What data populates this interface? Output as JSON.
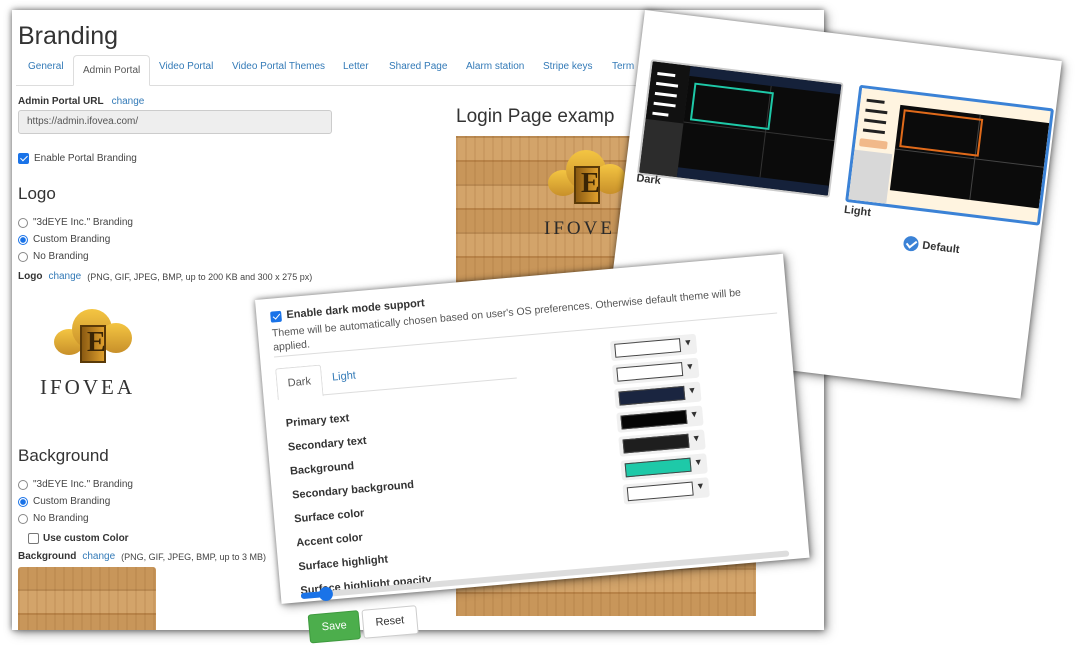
{
  "main": {
    "title": "Branding",
    "tabs": [
      {
        "label": "General"
      },
      {
        "label": "Admin Portal"
      },
      {
        "label": "Video Portal"
      },
      {
        "label": "Video Portal Themes"
      },
      {
        "label": "Letter"
      },
      {
        "label": "Shared Page"
      },
      {
        "label": "Alarm station"
      },
      {
        "label": "Stripe keys"
      },
      {
        "label": "Term"
      }
    ],
    "url_label": "Admin Portal URL",
    "url_change": "change",
    "url_value": "https://admin.ifovea.com/",
    "enable_branding": "Enable Portal Branding",
    "login_example": "Login Page examp",
    "logo_heading": "Logo",
    "logo_options": [
      "\"3dEYE Inc.\" Branding",
      "Custom Branding",
      "No Branding"
    ],
    "logo_label": "Logo",
    "logo_change": "change",
    "logo_hint": "(PNG, GIF, JPEG, BMP, up to 200 KB and 300 x 275 px)",
    "logo_word": "IFOVEA",
    "logo_word_small": "IFOVE",
    "bg_heading": "Background",
    "bg_options": [
      "\"3dEYE Inc.\" Branding",
      "Custom Branding",
      "No Branding"
    ],
    "use_custom_color": "Use custom Color",
    "bg_label": "Background",
    "bg_change": "change",
    "bg_hint": "(PNG, GIF, JPEG, BMP, up to 3 MB)"
  },
  "themes": {
    "dark_label": "Dark",
    "light_label": "Light",
    "default_label": "Default",
    "accent_dark": "#1ec9a8",
    "accent_light": "#e06a1a",
    "selected_color": "#3b82d6"
  },
  "darkmode": {
    "enable_label": "Enable dark mode support",
    "description": "Theme will be automatically chosen based on user's OS preferences. Otherwise default theme will be applied.",
    "tabs": [
      {
        "label": "Dark"
      },
      {
        "label": "Light"
      }
    ],
    "colors": [
      {
        "label": "Primary text",
        "color": "#ffffff"
      },
      {
        "label": "Secondary text",
        "color": "#ffffff"
      },
      {
        "label": "Background",
        "color": "#1a2540"
      },
      {
        "label": "Secondary background",
        "color": "#050505"
      },
      {
        "label": "Surface color",
        "color": "#1e1e1e"
      },
      {
        "label": "Accent color",
        "color": "#1ec9a8"
      },
      {
        "label": "Surface highlight",
        "color": "#ffffff"
      }
    ],
    "opacity_label": "Surface highlight opacity",
    "opacity_value": 0.05,
    "save": "Save",
    "reset": "Reset"
  }
}
